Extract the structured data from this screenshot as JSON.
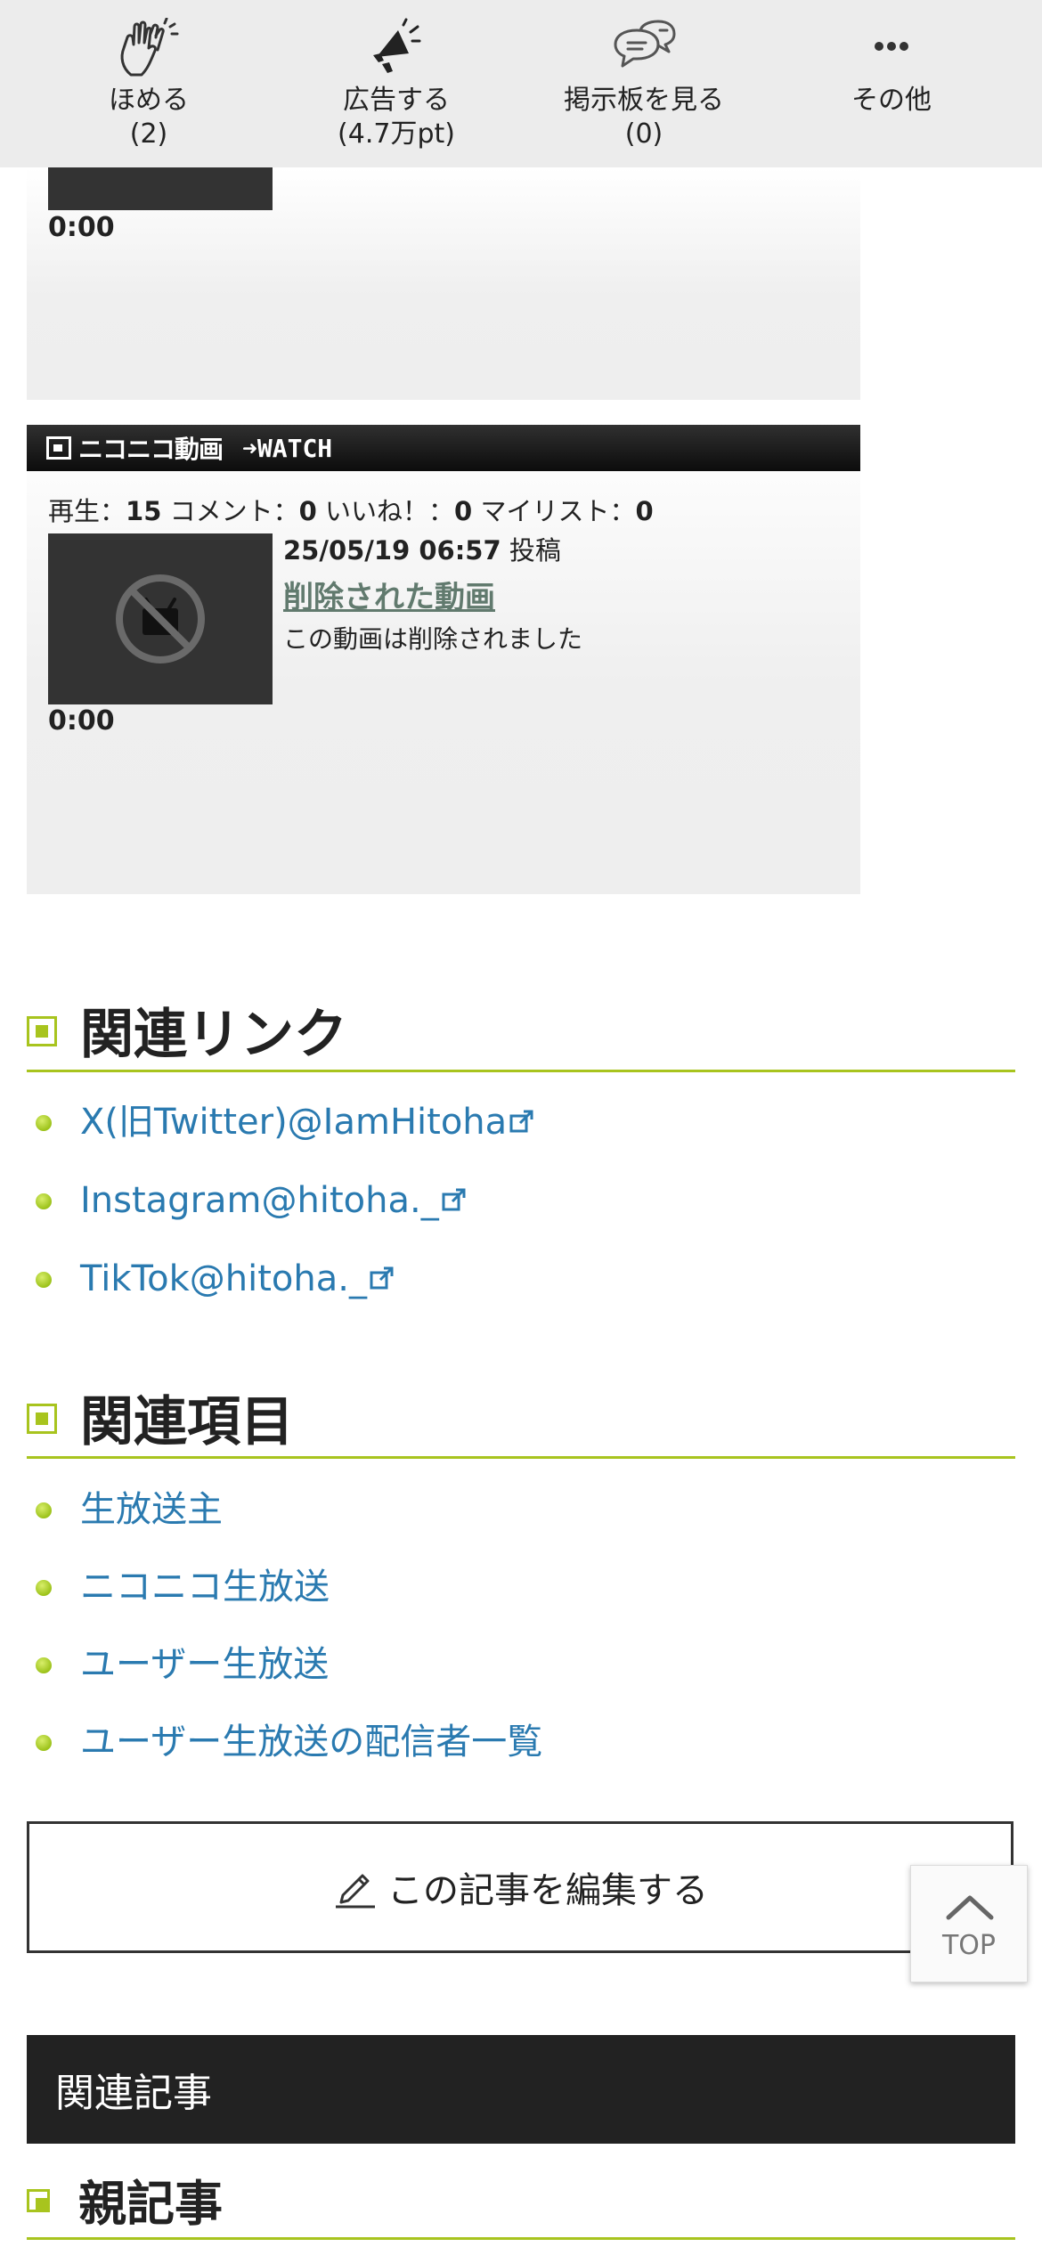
{
  "action_bar": {
    "praise": {
      "label": "ほめる",
      "count": "(2)"
    },
    "advertise": {
      "label": "広告する",
      "count": "(4.7万pt)"
    },
    "board": {
      "label": "掲示板を見る",
      "count": "(0)"
    },
    "more": {
      "label": "その他"
    }
  },
  "video_card_1": {
    "duration": "0:00"
  },
  "video_card_2": {
    "logo": "ニコニコ動画",
    "watch": "➜WATCH",
    "stats": {
      "play_label": "再生：",
      "play": "15",
      "comment_label": "コメント：",
      "comment": "0",
      "like_label": "いいね！：",
      "like": "0",
      "mylist_label": "マイリスト：",
      "mylist": "0"
    },
    "posted_date": "25/05/19 06:57",
    "posted_label": "投稿",
    "title": "削除された動画",
    "description": "この動画は削除されました",
    "duration": "0:00"
  },
  "related_links": {
    "heading": "関連リンク",
    "items": [
      {
        "label": "X(旧Twitter)@IamHitoha"
      },
      {
        "label": "Instagram@hitoha._"
      },
      {
        "label": "TikTok@hitoha._"
      }
    ]
  },
  "related_items": {
    "heading": "関連項目",
    "items": [
      {
        "label": "生放送主"
      },
      {
        "label": "ニコニコ生放送"
      },
      {
        "label": "ユーザー生放送"
      },
      {
        "label": "ユーザー生放送の配信者一覧"
      }
    ]
  },
  "edit_button": {
    "label": "この記事を編集する"
  },
  "top_button": {
    "label": "TOP"
  },
  "related_articles": {
    "heading": "関連記事",
    "parent_heading": "親記事"
  },
  "colors": {
    "accent_green": "#a8c41e",
    "link_blue": "#2a7ab0",
    "bar_gray": "#ececec",
    "dark_bar": "#222222"
  }
}
